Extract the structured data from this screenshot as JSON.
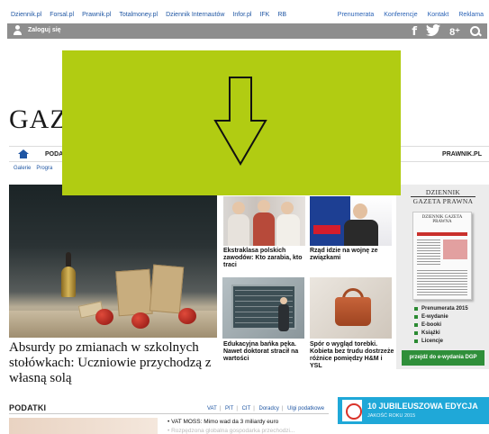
{
  "topbar": {
    "left_links": [
      "Dziennik.pl",
      "Forsal.pl",
      "Prawnik.pl",
      "Totalmoney.pl",
      "Dziennik Internautów",
      "Infor.pl",
      "IFK",
      "RB"
    ],
    "right_links": [
      "Prenumerata",
      "Konferencje",
      "Kontakt",
      "Reklama"
    ]
  },
  "userbar": {
    "login_label": "Zaloguj się"
  },
  "social": {
    "facebook": "f",
    "twitter": "🐦",
    "gplus": "8⁺"
  },
  "logo": {
    "text": "GAZ"
  },
  "nav": {
    "podatki": "PODAT",
    "prawnik": "PRAWNIK.PL"
  },
  "subnav": [
    "Galerie",
    "Progra"
  ],
  "hero": {
    "title": "Absurdy po zmianach w szkolnych stołówkach: Uczniowie przychodzą z własną solą"
  },
  "articles": [
    {
      "caption": "Ekstraklasa polskich zawodów: Kto zarabia, kto traci"
    },
    {
      "caption": "Rząd idzie na wojnę ze związkami"
    },
    {
      "caption": "Edukacyjna bańka pęka. Nawet doktorat stracił na wartości"
    },
    {
      "caption": "Spór o wygląd torebki. Kobieta bez trudu dostrzeże różnice pomiędzy H&M i YSL"
    }
  ],
  "sidebar": {
    "logo_line1": "DZIENNIK",
    "logo_line2": "GAZETA PRAWNA",
    "cover_head": "DZIENNIK GAZETA PRAWNA",
    "items": [
      "Prenumerata 2015",
      "E-wydanie",
      "E-booki",
      "Książki",
      "Licencje"
    ],
    "button": "przejdź do e-wydania DGP"
  },
  "section": {
    "title": "PODATKI",
    "tabs": [
      "VAT",
      "PIT",
      "CIT",
      "Doradcy",
      "Ulgi podatkowe"
    ],
    "items": [
      "VAT MOSS: Mimo wad da 3 miliardy euro",
      "Rozpędzona globalna gospodarka przechodzi..."
    ]
  },
  "jubilee": {
    "title": "10 JUBILEUSZOWA EDYCJA",
    "sub": "JAKOŚĆ ROKU 2015"
  },
  "colors": {
    "banner": "#b1cc12",
    "link": "#1f56a3",
    "green_button": "#2f8f3a",
    "jubilee": "#1fa8d8"
  }
}
